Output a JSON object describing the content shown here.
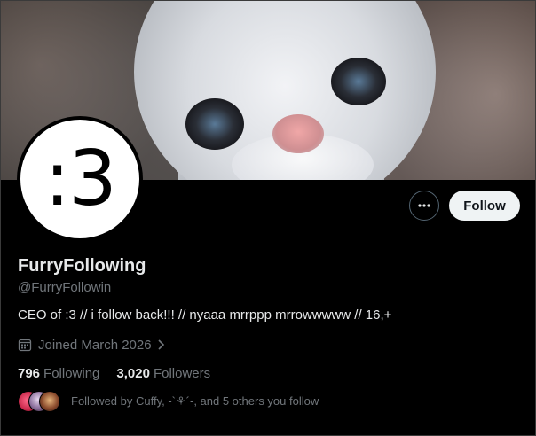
{
  "profile": {
    "display_name": "FurryFollowing",
    "handle": "@FurryFollowin",
    "avatar_text": ":3",
    "bio": "CEO of :3 // i follow back!!! // nyaaa mrrppp mrrowwwww // 16,+",
    "joined": "Joined March 2026"
  },
  "actions": {
    "follow_label": "Follow",
    "more_icon": "more-horizontal-icon"
  },
  "stats": {
    "following_count": "796",
    "following_label": "Following",
    "followers_count": "3,020",
    "followers_label": "Followers"
  },
  "followed_by": {
    "text": "Followed by Cuffy, -`⚘´-, and 5 others you follow"
  },
  "colors": {
    "background": "#000000",
    "text_primary": "#e7e9ea",
    "text_secondary": "#71767b",
    "follow_button_bg": "#eff3f4",
    "border": "#536471"
  }
}
